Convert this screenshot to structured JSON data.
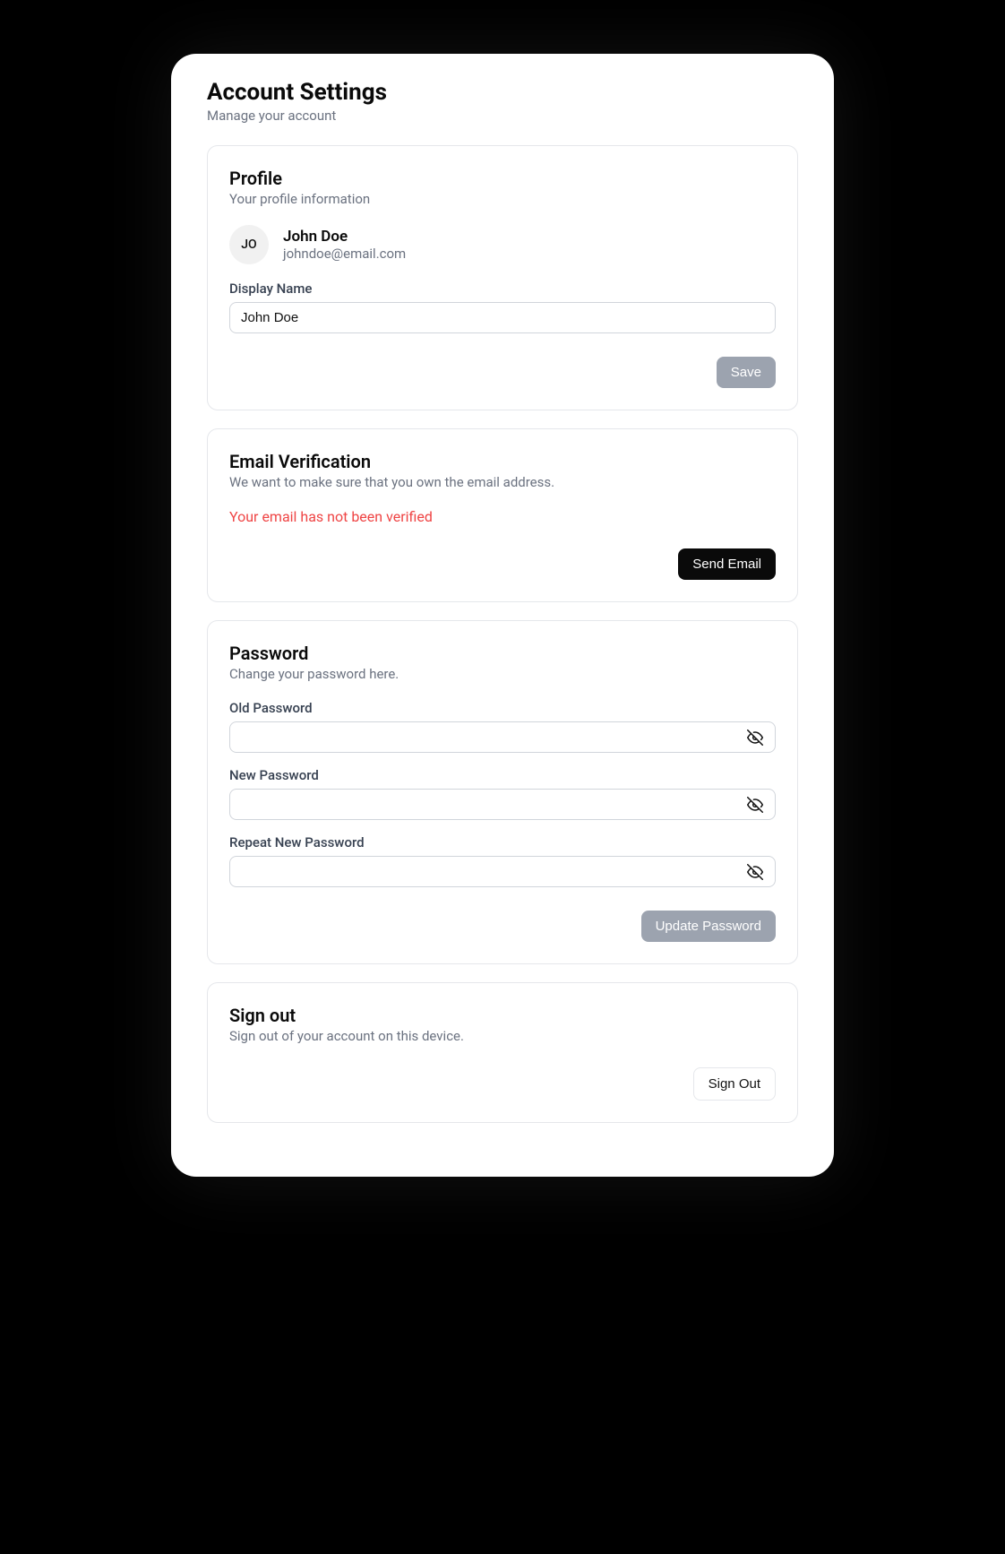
{
  "header": {
    "title": "Account Settings",
    "subtitle": "Manage your account"
  },
  "profile_card": {
    "title": "Profile",
    "subtitle": "Your profile information",
    "avatar_initials": "JO",
    "name": "John Doe",
    "email": "johndoe@email.com",
    "display_name_label": "Display Name",
    "display_name_value": "John Doe",
    "save_label": "Save"
  },
  "email_card": {
    "title": "Email Verification",
    "subtitle": "We want to make sure that you own the email address.",
    "status_text": "Your email has not been verified",
    "send_label": "Send Email"
  },
  "password_card": {
    "title": "Password",
    "subtitle": "Change your password here.",
    "old_label": "Old Password",
    "new_label": "New Password",
    "repeat_label": "Repeat New Password",
    "update_label": "Update Password"
  },
  "signout_card": {
    "title": "Sign out",
    "subtitle": "Sign out of your account on this device.",
    "signout_label": "Sign Out"
  }
}
